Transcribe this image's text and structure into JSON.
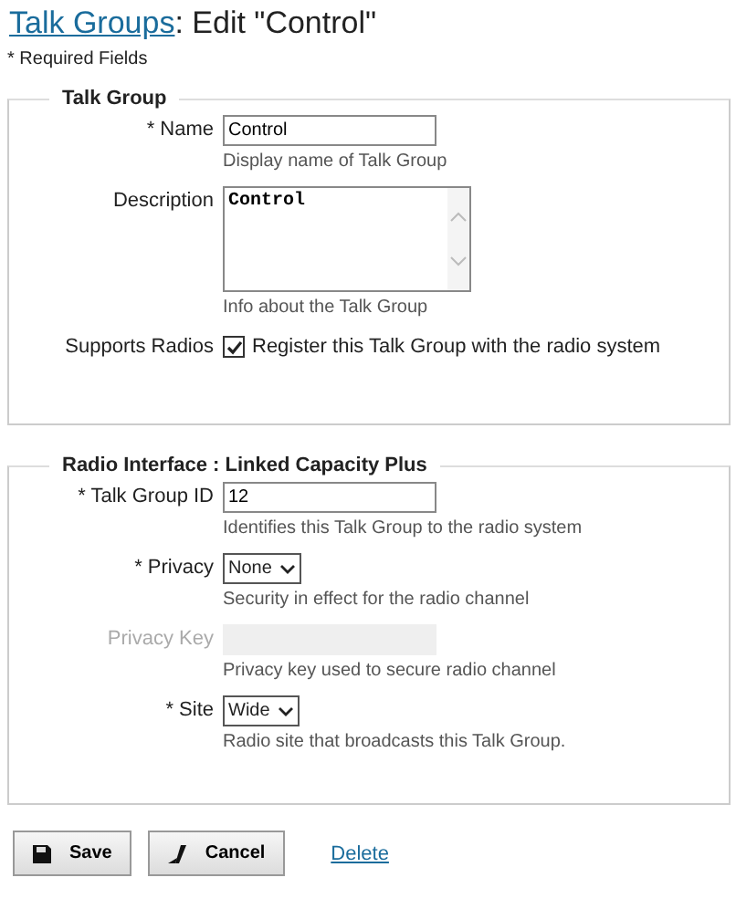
{
  "header": {
    "link": "Talk Groups",
    "title": ": Edit \"Control\""
  },
  "required_note": "* Required Fields",
  "sections": [
    {
      "legend": "Talk Group",
      "fields": [
        {
          "kind": "text",
          "label": "* Name",
          "value": "Control",
          "hint": "Display name of Talk Group",
          "disabled": false
        },
        {
          "kind": "textarea",
          "label": "Description",
          "value": "Control",
          "hint": "Info about the Talk Group"
        },
        {
          "kind": "checkbox",
          "label": "Supports Radios",
          "checked": true,
          "text": "Register this Talk Group with the radio system"
        }
      ]
    },
    {
      "legend": "Radio Interface : Linked Capacity Plus",
      "fields": [
        {
          "kind": "text",
          "label": "* Talk Group ID",
          "value": "12",
          "hint": "Identifies this Talk Group to the radio system",
          "disabled": false
        },
        {
          "kind": "select",
          "label": "* Privacy",
          "value": "None",
          "hint": "Security in effect for the radio channel"
        },
        {
          "kind": "text",
          "label": "Privacy Key",
          "hint": "Privacy key used to secure radio channel",
          "disabled": true
        },
        {
          "kind": "select",
          "label": "* Site",
          "value": "Wide",
          "hint": "Radio site that broadcasts this Talk Group."
        }
      ]
    }
  ],
  "buttons": [
    {
      "kind": "save",
      "label": "Save"
    },
    {
      "kind": "cancel",
      "label": "Cancel"
    }
  ],
  "delete_link": "Delete"
}
